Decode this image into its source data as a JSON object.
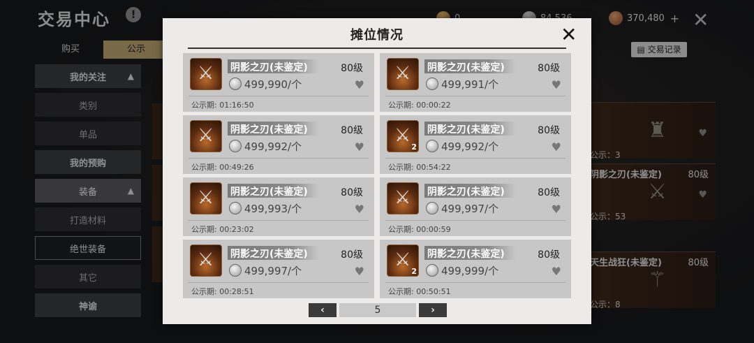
{
  "header": {
    "title": "交易中心",
    "info_icon": "!",
    "currencies": [
      {
        "icon": "gold-coin",
        "value": "0"
      },
      {
        "icon": "silver-coin",
        "value": "84,536"
      },
      {
        "icon": "copper-coin",
        "value": "370,480"
      }
    ],
    "plus": "+",
    "close": "✕"
  },
  "tabs": [
    {
      "label": "购买"
    },
    {
      "label": "公示"
    }
  ],
  "record_button": "交易记录",
  "sidebar": {
    "items": [
      {
        "label": "我的关注",
        "type": "head",
        "chevron": "▲"
      },
      {
        "label": "类别",
        "type": "normal"
      },
      {
        "label": "单品",
        "type": "normal"
      },
      {
        "label": "我的预购",
        "type": "head"
      },
      {
        "label": "装备",
        "type": "selected",
        "chevron": "▲"
      },
      {
        "label": "打造材料",
        "type": "normal"
      },
      {
        "label": "绝世装备",
        "type": "outlined"
      },
      {
        "label": "其它",
        "type": "normal"
      },
      {
        "label": "神谕",
        "type": "head"
      }
    ]
  },
  "right_cards": [
    {
      "name": "",
      "level": "",
      "pub": "公示：3"
    },
    {
      "name": "阴影之刃(未鉴定)",
      "level": "80级",
      "pub": "公示：53"
    },
    {
      "name": "天生战狂(未鉴定)",
      "level": "80级",
      "pub": "公示：8"
    }
  ],
  "modal": {
    "title": "摊位情况",
    "close": "✕",
    "listings": [
      {
        "name": "阴影之刃(未鉴定)",
        "level": "80级",
        "price": "499,990/个",
        "pub": "公示期: 01:16:50",
        "qty": ""
      },
      {
        "name": "阴影之刃(未鉴定)",
        "level": "80级",
        "price": "499,991/个",
        "pub": "公示期: 00:00:22",
        "qty": ""
      },
      {
        "name": "阴影之刃(未鉴定)",
        "level": "80级",
        "price": "499,992/个",
        "pub": "公示期: 00:49:26",
        "qty": ""
      },
      {
        "name": "阴影之刃(未鉴定)",
        "level": "80级",
        "price": "499,992/个",
        "pub": "公示期: 00:54:22",
        "qty": "2"
      },
      {
        "name": "阴影之刃(未鉴定)",
        "level": "80级",
        "price": "499,993/个",
        "pub": "公示期: 00:23:02",
        "qty": ""
      },
      {
        "name": "阴影之刃(未鉴定)",
        "level": "80级",
        "price": "499,997/个",
        "pub": "公示期: 00:00:59",
        "qty": ""
      },
      {
        "name": "阴影之刃(未鉴定)",
        "level": "80级",
        "price": "499,997/个",
        "pub": "公示期: 00:28:51",
        "qty": ""
      },
      {
        "name": "阴影之刃(未鉴定)",
        "level": "80级",
        "price": "499,999/个",
        "pub": "公示期: 00:50:51",
        "qty": "2"
      }
    ],
    "pager": {
      "prev": "‹",
      "page": "5",
      "next": "›"
    }
  }
}
